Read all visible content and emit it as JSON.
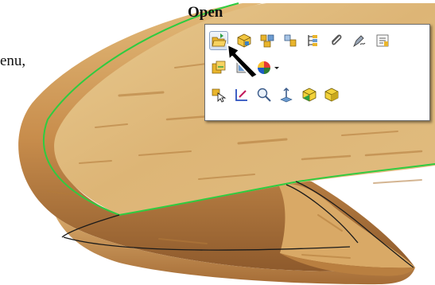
{
  "document": {
    "heading_fragment": "Open",
    "line_fragment": "enu,"
  },
  "toolbar": {
    "rows": [
      [
        "open-folder-icon",
        "cube-icon",
        "assembly-icon",
        "components-icon",
        "feature-tree-icon",
        "paperclip-icon",
        "pen-tool-icon",
        "properties-icon"
      ],
      [
        "sketch-icon",
        "display-icon",
        "color-wheel-icon",
        "dropdown-caret-icon"
      ],
      [
        "select-icon",
        "edit-sketch-icon",
        "zoom-icon",
        "normal-to-icon",
        "hide-show-icon",
        "shaded-icon"
      ]
    ]
  },
  "colors": {
    "wood_light": "#e6c58c",
    "wood_mid": "#cf9a57",
    "wood_dark": "#9a6431",
    "edge_highlight": "#2ecc40",
    "toolbar_border": "#6e6e6e",
    "active_button": "#d3dff0"
  }
}
